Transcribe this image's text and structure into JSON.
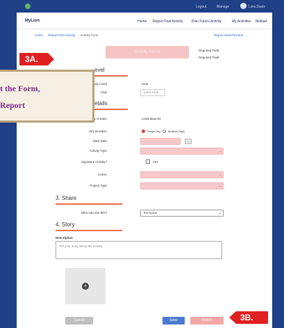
{
  "topbar": {
    "links": [
      "Logout",
      "Manage",
      "Lora Davis"
    ]
  },
  "navbar": {
    "brand": "MyLion",
    "links": [
      "Home",
      "Report Past Activity",
      "Plan Future Activity",
      "My Activities",
      "Multiad"
    ]
  },
  "breadcrumb": [
    "Home",
    "Report Past Activity",
    "Activity Form"
  ],
  "report_link": "Report Search/Home",
  "title": "Activity Name",
  "required": [
    "Required Field",
    "Required Field"
  ],
  "sections": {
    "level_tail": "evel",
    "details_tail": "etails",
    "share": "3. Share",
    "story": "4. Story"
  },
  "fields": {
    "activity_level_label": "Activity Level",
    "activity_level_value": "Club",
    "club_label": "Club",
    "club_value": "Lions Club",
    "activity_creator_label": "ivity Creator",
    "activity_creator_value": "Linda Baumer",
    "duration_label": "ivity Duration",
    "duration_opt1": "Single Day",
    "duration_opt2": "Multiple Days",
    "start_date_label": "Start Date",
    "activity_type_label": "Activity Type",
    "signature_label": "Signature Activity?",
    "signature_value": "Yes",
    "cause_label": "Cause",
    "project_type_label": "Project Type",
    "who_label": "Who can see this?",
    "who_value": "Everyone",
    "description_label": "Description",
    "description_placeholder": "Tell your story about the activity"
  },
  "buttons": {
    "cancel": "Cancel",
    "save": "Save",
    "report": "Report"
  },
  "badges": {
    "a": "3A.",
    "b": "3B."
  },
  "callout": {
    "line1": "t the Form,",
    "line2": "Report"
  },
  "colors": {
    "frame_blue": "#1f3f86",
    "accent_red": "#e02020",
    "pink": "#f8c9cb",
    "section_line": "#f06b4b",
    "callout_text": "#7a2a8b"
  }
}
